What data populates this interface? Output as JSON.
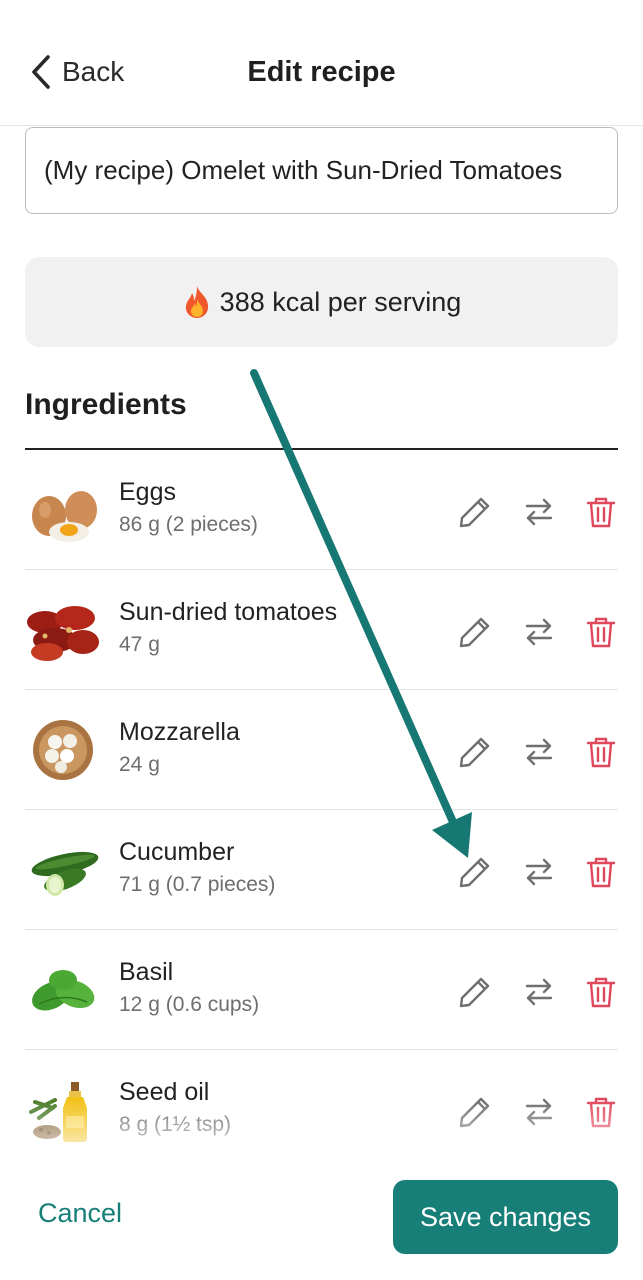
{
  "header": {
    "back_label": "Back",
    "title": "Edit recipe"
  },
  "recipe": {
    "name_value": "(My recipe) Omelet with Sun-Dried Tomatoes",
    "kcal_text": "388 kcal per serving"
  },
  "ingredients": {
    "title": "Ingredients",
    "items": [
      {
        "name": "Eggs",
        "amount": "86 g (2 pieces)",
        "icon": "eggs-image"
      },
      {
        "name": "Sun-dried tomatoes",
        "amount": "47 g",
        "icon": "sun-dried-tomatoes-image"
      },
      {
        "name": "Mozzarella",
        "amount": "24 g",
        "icon": "mozzarella-image"
      },
      {
        "name": "Cucumber",
        "amount": "71 g (0.7 pieces)",
        "icon": "cucumber-image"
      },
      {
        "name": "Basil",
        "amount": "12 g (0.6 cups)",
        "icon": "basil-image"
      },
      {
        "name": "Seed oil",
        "amount": "8 g (1½ tsp)",
        "icon": "seed-oil-image"
      }
    ]
  },
  "footer": {
    "cancel_label": "Cancel",
    "save_label": "Save changes"
  },
  "colors": {
    "accent": "#177f78",
    "delete": "#e0475b",
    "annotation_arrow": "#177873"
  }
}
